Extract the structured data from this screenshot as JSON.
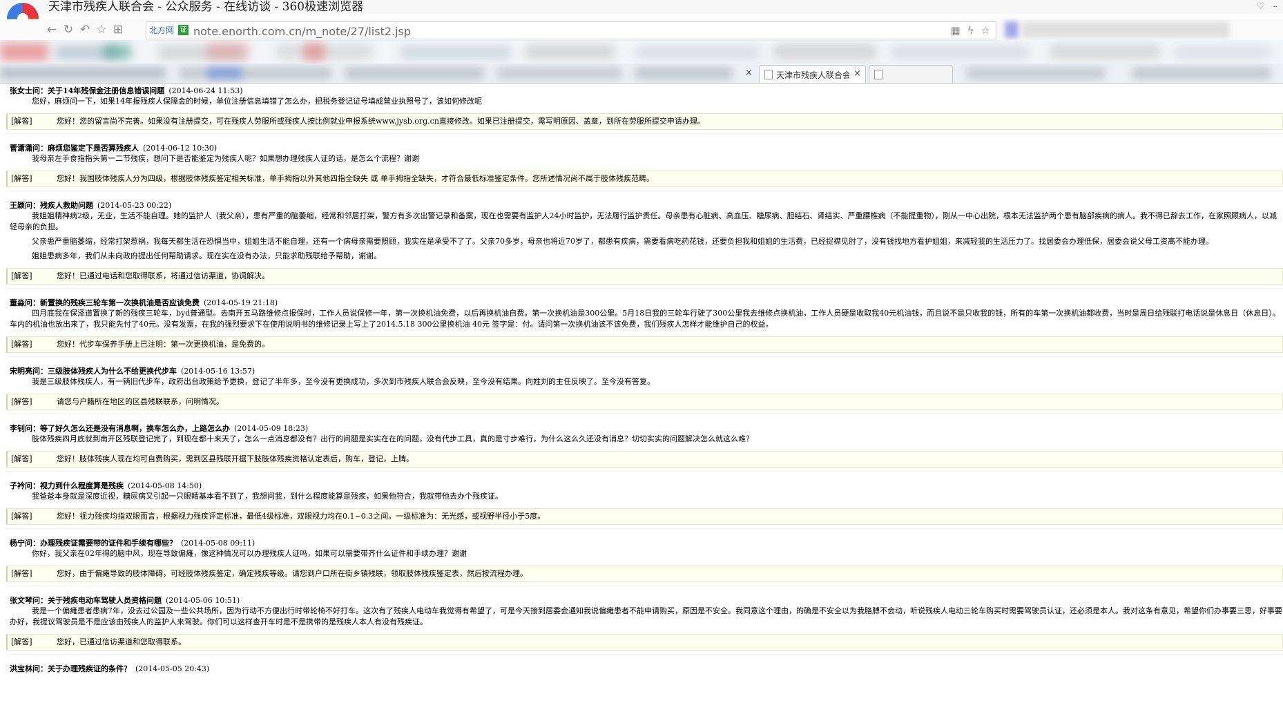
{
  "browser": {
    "window_title": "天津市残疾人联合会 - 公众服务 - 在线访谈 - 360极速浏览器",
    "address": {
      "site_label": "北方网",
      "cert_label": "证",
      "url": "note.enorth.com.cn/m_note/27/list2.jsp"
    },
    "tab": {
      "title": "天津市残疾人联合会",
      "close_glyph": "×"
    },
    "prev_tab_close_glyph": "×"
  },
  "answer_tag": "[解答]",
  "entries": [
    {
      "name": "张女士问：关于14年残保金注册信息错误问题",
      "date": "(2014-06-24 11:53)",
      "body": [
        "您好，麻烦问一下，如果14年报残疾人保障金的时候，单位注册信息填错了怎么办，把税务登记证号填成营业执照号了，该如何修改呢"
      ],
      "answer": "您好！您的留言尚不完善。如果没有注册提交，可在残疾人劳服所或残疾人按比例就业申报系统www.jysb.org.cn直接修改。如果已注册提交，需写明原因、盖章，到所在劳服所提交申请办理。"
    },
    {
      "name": "菅潇潇问：麻烦您鉴定下是否算残疾人",
      "date": "(2014-06-12 10:30)",
      "body": [
        "我母亲左手食指指头第一二节残疾，想问下是否能鉴定为残疾人呢？如果想办理残疾人证的话，是怎么个流程？谢谢"
      ],
      "answer": "您好！我国肢体残疾人分为四级，根据肢体残疾鉴定相关标准，单手拇指以外其他四指全缺失 或 单手拇指全缺失，才符合最低标准鉴定条件。您所述情况尚不属于肢体残疾范畴。"
    },
    {
      "name": "王颖问：残疾人救助问题",
      "date": "(2014-05-23 00:22)",
      "body": [
        "我姐姐精神病2级，无业，生活不能自理。她的监护人（我父亲），患有严重的脑萎缩，经常和邻居打架，警方有多次出警记录和备案，现在也需要有监护人24小时监护，无法履行监护责任。母亲患有心脏病、高血压、糖尿病、胆结石、肾结实、严重腰椎病（不能提重物），刚从一中心出院，根本无法监护两个患有脑部疾病的病人。我不得已辞去工作，在家照顾病人，以减轻母亲的负担。",
        "父亲患严重脑萎缩，经常打架惹祸，我每天都生活在恐惧当中，姐姐生活不能自理，还有一个病母亲需要照顾，我实在是承受不了了。父亲70多岁，母亲也将近70岁了，都患有疾病，需要看病吃药花钱，还要负担我和姐姐的生活费，已经捉襟见肘了，没有钱找地方看护姐姐，来减轻我的生活压力了。找居委会办理低保，居委会说父母工资高不能办理。",
        "姐姐患病多年，我们从未向政府提出任何帮助请求。现在实在没有办法，只能求助残联给予帮助，谢谢。"
      ],
      "answer": "您好！已通过电话和您取得联系，将通过信访渠道，协调解决。"
    },
    {
      "name": "董淼问：新置换的残疾三轮车第一次换机油是否应该免费",
      "date": "(2014-05-19 21:18)",
      "body": [
        "四月底我在保泽道置换了新的残疾三轮车，byd普通型。去南开五马路维修点报保时，工作人员说保修一年，第一次换机油免费，以后再换机油自费。第一次换机油是300公里。5月18日我的三轮车行驶了300公里我去维修点换机油，工作人员硬是收取我40元机油钱，而且说不是只收我的钱，所有的车第一次换机油都收费，当时是周日给残联打电话说是休息日（休息日）。车内的机油也放出来了，我只能先付了40元。没有发票，在我的强烈要求下在使用说明书的维修记录上写上了2014.5.18 300公里换机油 40元 签字是：付。请问第一次换机油该不该免费，我们残疾人怎样才能维护自己的权益。"
      ],
      "answer": "您好！代步车保养手册上已注明：第一次更换机油，是免费的。"
    },
    {
      "name": "宋明亮问：三级肢体残疾人为什么不给更换代步车",
      "date": "(2014-05-16 13:57)",
      "body": [
        "我是三级肢体残疾人，有一辆旧代步车，政府出台政策给予更换，登记了半年多，至今没有更换成功，多次到市残疾人联合会反映，至今没有结果。向姓刘的主任反映了。至今没有答复。"
      ],
      "answer": "请您与户籍所在地区的区县残联联系，问明情况。"
    },
    {
      "name": "李钊问：等了好久怎么还是没有消息啊，换车怎么办，上路怎么办",
      "date": "(2014-05-09 18:23)",
      "body": [
        "肢体残疾四月底就到南开区残联登记完了，到现在都十来天了，怎么一点消息都没有？出行的问题是实实在在的问题，没有代步工具，真的是寸步难行，为什么这么久还没有消息？切切实实的问题解决怎么就这么难？"
      ],
      "answer": "您好！肢体残疾人现在均可自费购买，需到区县残联开据下肢肢体残疾资格认定表后，购车，登记，上牌。"
    },
    {
      "name": "子衿问：视力到什么程度算是残疾",
      "date": "(2014-05-08 14:50)",
      "body": [
        "我爸爸本身就是深度近视，糖尿病又引起一只眼睛基本看不到了，我想问我，到什么程度能算是残疾，如果他符合，我就带他去办个残疾证。"
      ],
      "answer": "您好！视力残疾均指双眼而言，根据视力残疾评定标准，最低4级标准，双眼视力均在0.1~0.3之间。一级标准为：无光感，或视野半径小于5度。"
    },
    {
      "name": "杨宁问：办理残疾证需要带的证件和手续有哪些？",
      "date": "(2014-05-08 09:11)",
      "body": [
        "你好，我父亲在02年得的脑中风，现在导致偏瘫，像这种情况可以办理残疾人证吗，如果可以需要带齐什么证件和手续办理？谢谢"
      ],
      "answer": "您好，由于偏瘫导致的肢体障碍，可经肢体残疾鉴定，确定残疾等级。请您到户口所在街乡镇残联，领取肢体残疾鉴定表，然后按流程办理。"
    },
    {
      "name": "张文琴问：关于残疾电动车驾驶人员资格问题",
      "date": "(2014-05-06 10:51)",
      "body": [
        "我是一个偏瘫患者患病7年，没去过公园及一些公共场所，因为行动不方便出行时带轮椅不好打车。这次有了残疾人电动车我觉得有希望了，可是今天接到居委会通知我说偏瘫患者不能申请购买，原因是不安全。我同意这个理由，的确是不安全以为我胳膊不会动，听说残疾人电动三轮车购买时需要驾驶员认证，还必须是本人。我对这条有意见，希望你们办事要三思，好事要办好，我提议驾驶员是不是应该由残疾人的监护人来驾驶。你们可以这样查开车时是不是携带的是残疾人本人有没有残疾证。"
      ],
      "answer": "您好，已通过信访渠道和您取得联系。"
    },
    {
      "name": "洪宝林问：关于办理残疾证的条件？",
      "date": "(2014-05-05 20:43)",
      "body": [],
      "answer": ""
    }
  ]
}
